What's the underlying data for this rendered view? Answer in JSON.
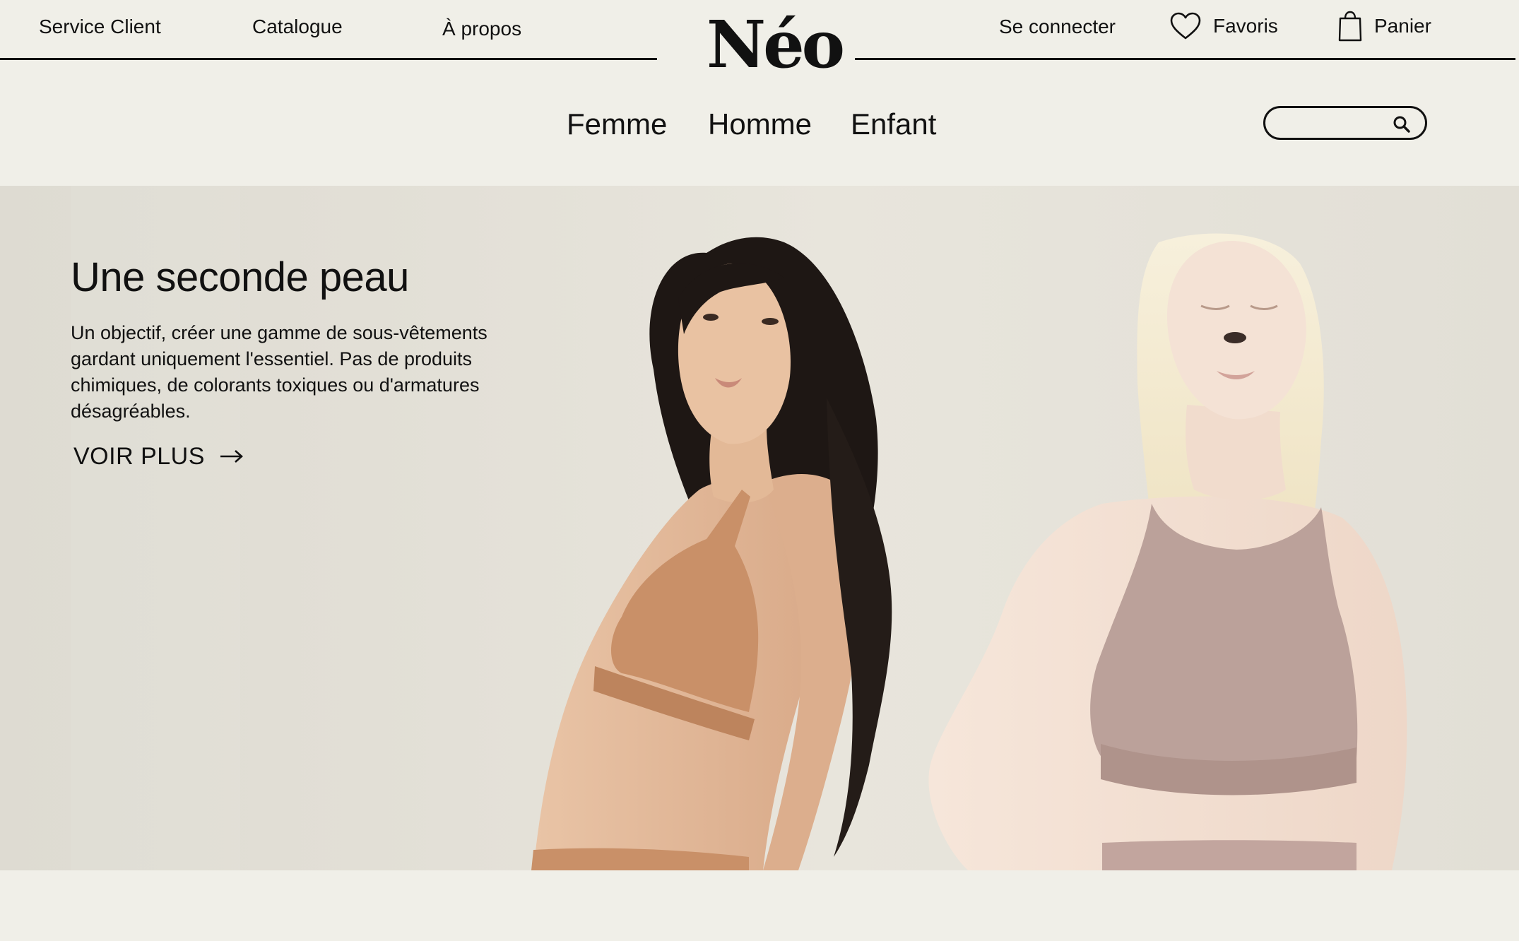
{
  "header": {
    "left_links": [
      "Service Client",
      "Catalogue",
      "À propos"
    ],
    "logo": "Néo",
    "login": "Se connecter",
    "favorites": "Favoris",
    "cart": "Panier"
  },
  "nav": {
    "categories": [
      "Femme",
      "Homme",
      "Enfant"
    ],
    "search": {
      "placeholder": "",
      "value": ""
    }
  },
  "hero": {
    "title": "Une seconde peau",
    "text": "Un objectif, créer une gamme de sous-vêtements gardant uniquement l'essentiel. Pas de produits chimiques, de colorants toxiques ou d'armatures désagréables.",
    "cta": "VOIR PLUS"
  },
  "icons": [
    "heart-icon",
    "shopping-bag-icon",
    "search-icon",
    "arrow-right-icon"
  ],
  "colors": {
    "background": "#f0efe8",
    "text": "#111111",
    "hero_background": "#e3e0d7",
    "bra_tan": "#c9936b",
    "bra_mauve": "#bba19a"
  }
}
